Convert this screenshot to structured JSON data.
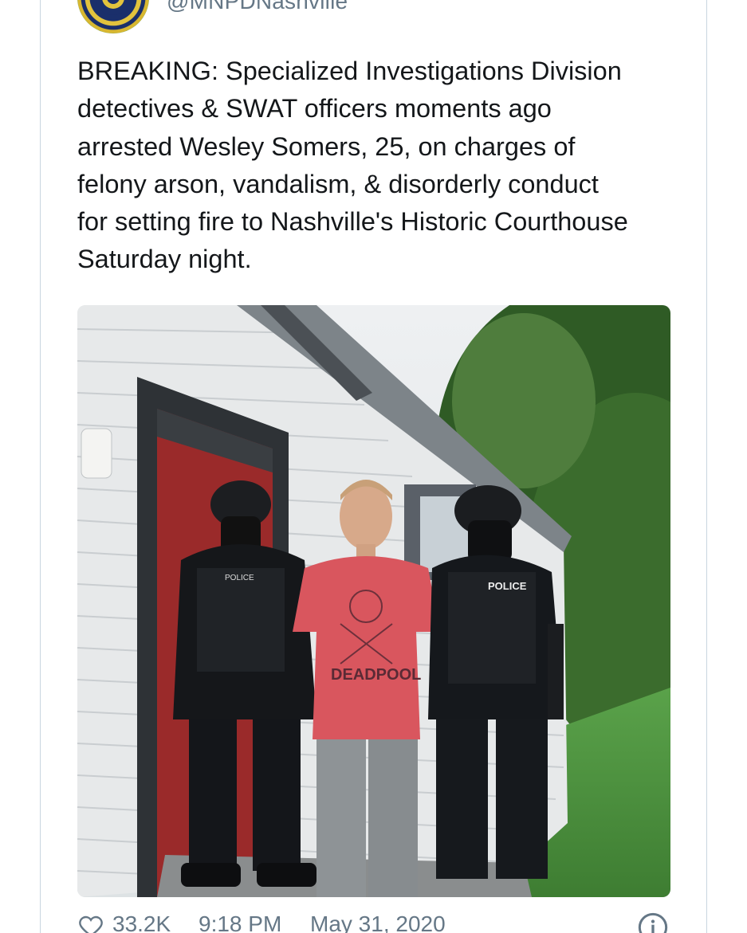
{
  "tweet": {
    "handle": "@MNPDNashville",
    "text": "BREAKING: Specialized Investigations Division\ndetectives & SWAT officers moments ago\narrested Wesley Somers, 25, on charges of\nfelony arson, vandalism, & disorderly conduct\nfor setting fire to Nashville's Historic Courthouse\nSaturday night.",
    "likes": "33.2K",
    "time": "9:18 PM",
    "date": "May 31, 2020",
    "avatar_icon": "police-badge-icon",
    "heart_icon": "heart-icon",
    "info_icon": "info-icon"
  },
  "photo": {
    "shirt_text": "DEADPOOL",
    "vest_text": "POLICE",
    "vest_text_left": "POLICE"
  },
  "colors": {
    "text": "#14171a",
    "secondary": "#657786",
    "border": "#c8d6e0"
  }
}
